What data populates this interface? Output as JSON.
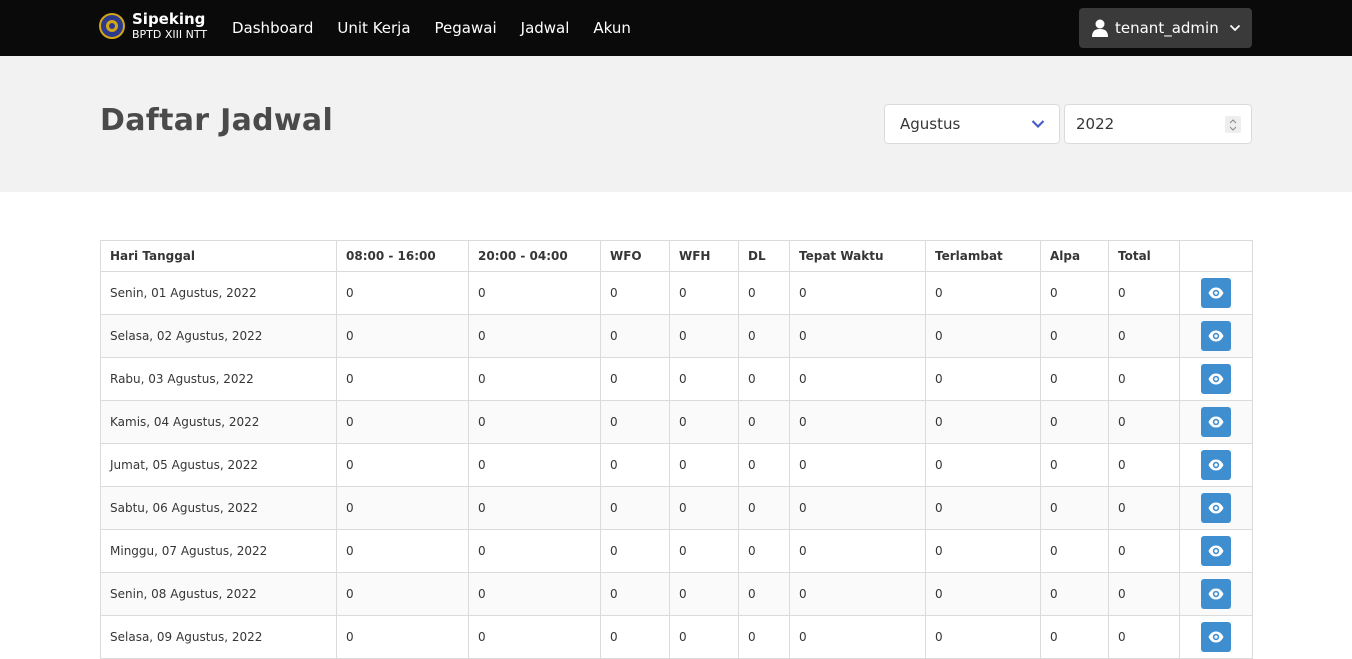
{
  "brand": {
    "title": "Sipeking",
    "subtitle": "BPTD XIII NTT"
  },
  "nav": {
    "items": [
      {
        "label": "Dashboard"
      },
      {
        "label": "Unit Kerja"
      },
      {
        "label": "Pegawai"
      },
      {
        "label": "Jadwal"
      },
      {
        "label": "Akun"
      }
    ]
  },
  "user": {
    "name": "tenant_admin",
    "icon": "user-icon"
  },
  "page": {
    "title": "Daftar Jadwal"
  },
  "filters": {
    "month": "Agustus",
    "year": "2022"
  },
  "colors": {
    "navbar": "#0a0a0a",
    "accent": "#3e8ed0",
    "chevron": "#485fc7"
  },
  "table": {
    "headers": [
      "Hari Tanggal",
      "08:00 - 16:00",
      "20:00 - 04:00",
      "WFO",
      "WFH",
      "DL",
      "Tepat Waktu",
      "Terlambat",
      "Alpa",
      "Total",
      ""
    ],
    "rows": [
      {
        "date": "Senin, 01 Agustus, 2022",
        "values": [
          "0",
          "0",
          "0",
          "0",
          "0",
          "0",
          "0",
          "0",
          "0"
        ]
      },
      {
        "date": "Selasa, 02 Agustus, 2022",
        "values": [
          "0",
          "0",
          "0",
          "0",
          "0",
          "0",
          "0",
          "0",
          "0"
        ]
      },
      {
        "date": "Rabu, 03 Agustus, 2022",
        "values": [
          "0",
          "0",
          "0",
          "0",
          "0",
          "0",
          "0",
          "0",
          "0"
        ]
      },
      {
        "date": "Kamis, 04 Agustus, 2022",
        "values": [
          "0",
          "0",
          "0",
          "0",
          "0",
          "0",
          "0",
          "0",
          "0"
        ]
      },
      {
        "date": "Jumat, 05 Agustus, 2022",
        "values": [
          "0",
          "0",
          "0",
          "0",
          "0",
          "0",
          "0",
          "0",
          "0"
        ]
      },
      {
        "date": "Sabtu, 06 Agustus, 2022",
        "values": [
          "0",
          "0",
          "0",
          "0",
          "0",
          "0",
          "0",
          "0",
          "0"
        ]
      },
      {
        "date": "Minggu, 07 Agustus, 2022",
        "values": [
          "0",
          "0",
          "0",
          "0",
          "0",
          "0",
          "0",
          "0",
          "0"
        ]
      },
      {
        "date": "Senin, 08 Agustus, 2022",
        "values": [
          "0",
          "0",
          "0",
          "0",
          "0",
          "0",
          "0",
          "0",
          "0"
        ]
      },
      {
        "date": "Selasa, 09 Agustus, 2022",
        "values": [
          "0",
          "0",
          "0",
          "0",
          "0",
          "0",
          "0",
          "0",
          "0"
        ]
      }
    ],
    "action_icon": "eye-icon"
  }
}
